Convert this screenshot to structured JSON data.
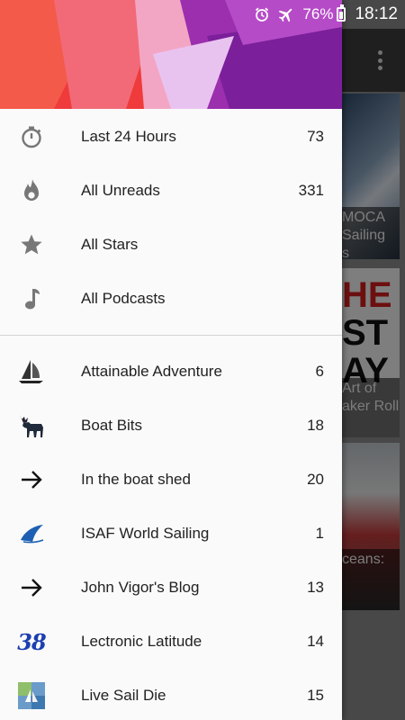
{
  "status_bar": {
    "battery_percent": "76%",
    "time": "18:12",
    "icons": [
      "alarm-icon",
      "airplane-mode-icon",
      "battery-icon"
    ]
  },
  "background_cards": [
    {
      "caption_lines": [
        "MOCA",
        "Sailing",
        "s"
      ]
    },
    {
      "big_lines": [
        "HE",
        "ST",
        "AY"
      ],
      "caption_lines": [
        "Art of",
        "aker Roll",
        ""
      ]
    },
    {
      "caption_lines": [
        "ceans:",
        "",
        ""
      ]
    }
  ],
  "drawer": {
    "smart_folders": [
      {
        "icon": "timer-icon",
        "label": "Last 24 Hours",
        "count": "73"
      },
      {
        "icon": "fire-icon",
        "label": "All Unreads",
        "count": "331"
      },
      {
        "icon": "star-icon",
        "label": "All Stars",
        "count": ""
      },
      {
        "icon": "music-note-icon",
        "label": "All Podcasts",
        "count": ""
      }
    ],
    "feeds": [
      {
        "icon": "sailboat-favicon",
        "label": "Attainable Adventure",
        "count": "6"
      },
      {
        "icon": "moose-favicon",
        "label": "Boat Bits",
        "count": "18"
      },
      {
        "icon": "arrow-right-icon",
        "label": "In the boat shed",
        "count": "20"
      },
      {
        "icon": "isaf-favicon",
        "label": "ISAF World Sailing",
        "count": "1"
      },
      {
        "icon": "arrow-right-icon",
        "label": "John Vigor's Blog",
        "count": "13"
      },
      {
        "icon": "number-38-favicon",
        "label": "Lectronic Latitude",
        "count": "14",
        "icon_text": "38"
      },
      {
        "icon": "live-sail-die-favicon",
        "label": "Live Sail Die",
        "count": "15"
      }
    ]
  }
}
